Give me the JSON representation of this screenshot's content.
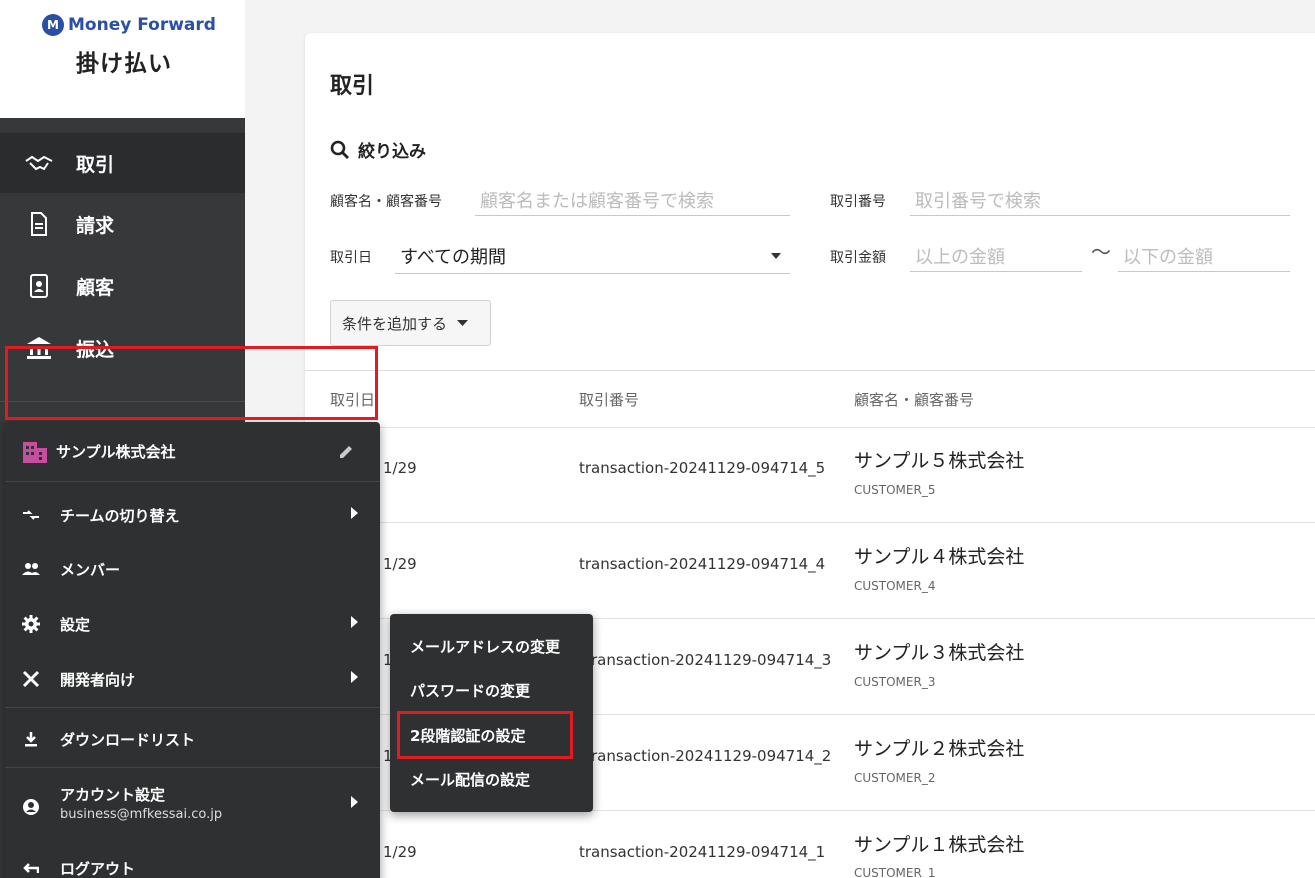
{
  "brand": {
    "name": "Money Forward",
    "product": "掛け払い"
  },
  "nav": {
    "items": [
      {
        "label": "取引",
        "icon": "handshake-icon",
        "active": true
      },
      {
        "label": "請求",
        "icon": "document-icon",
        "active": false
      },
      {
        "label": "顧客",
        "icon": "contact-card-icon",
        "active": false
      },
      {
        "label": "振込",
        "icon": "bank-icon",
        "active": false
      }
    ]
  },
  "main": {
    "title": "取引",
    "filter": {
      "title": "絞り込み",
      "customer_label": "顧客名・顧客番号",
      "customer_placeholder": "顧客名または顧客番号で検索",
      "txno_label": "取引番号",
      "txno_placeholder": "取引番号で検索",
      "date_label": "取引日",
      "date_value": "すべての期間",
      "amount_label": "取引金額",
      "amount_min_placeholder": "以上の金額",
      "amount_sep": "〜",
      "amount_max_placeholder": "以下の金額",
      "add_condition": "条件を追加する"
    },
    "table": {
      "headers": [
        "取引日",
        "取引番号",
        "顧客名・顧客番号"
      ],
      "rows": [
        {
          "date": "1/29",
          "tx": "transaction-20241129-094714_5",
          "customer": "サンプル５株式会社",
          "code": "CUSTOMER_5"
        },
        {
          "date": "1/29",
          "tx": "transaction-20241129-094714_4",
          "customer": "サンプル４株式会社",
          "code": "CUSTOMER_4"
        },
        {
          "date": "1",
          "tx": "ransaction-20241129-094714_3",
          "customer": "サンプル３株式会社",
          "code": "CUSTOMER_3"
        },
        {
          "date": "1",
          "tx": "ransaction-20241129-094714_2",
          "customer": "サンプル２株式会社",
          "code": "CUSTOMER_2"
        },
        {
          "date": "1/29",
          "tx": "transaction-20241129-094714_1",
          "customer": "サンプル１株式会社",
          "code": "CUSTOMER_1"
        }
      ]
    }
  },
  "account_menu": {
    "company": "サンプル株式会社",
    "items": {
      "switch_team": "チームの切り替え",
      "members": "メンバー",
      "settings": "設定",
      "developers": "開発者向け",
      "download_list": "ダウンロードリスト",
      "account_settings": "アカウント設定",
      "account_email": "business@mfkessai.co.jp",
      "logout": "ログアウト"
    }
  },
  "account_submenu": {
    "items": [
      "メールアドレスの変更",
      "パスワードの変更",
      "2段階認証の設定",
      "メール配信の設定"
    ]
  },
  "colors": {
    "sidebar": "#37383a",
    "highlight": "#e21b23",
    "brand": "#2a4fa6"
  }
}
